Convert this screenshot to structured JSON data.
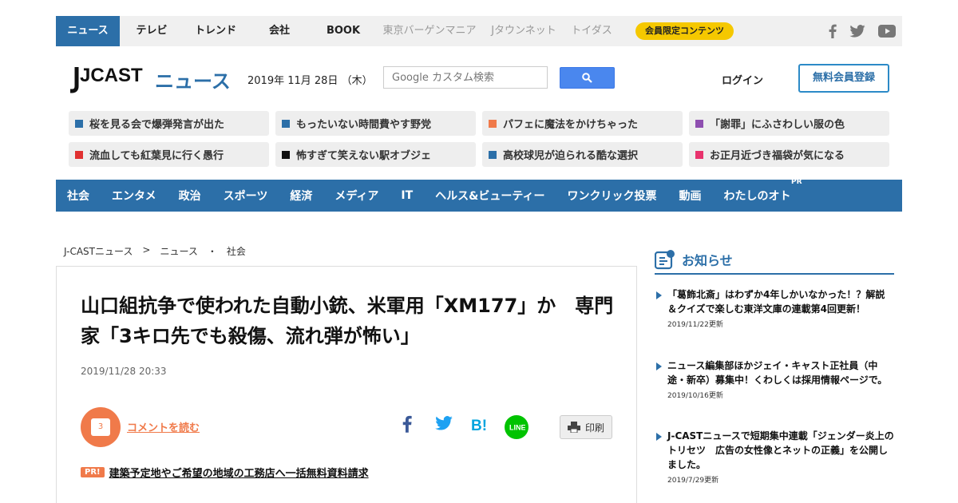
{
  "topnav": {
    "items": [
      "ニュース",
      "テレビ",
      "トレンド",
      "会社",
      "BOOK",
      "東京バーゲンマニア",
      "Jタウンネット",
      "トイダス"
    ],
    "members_badge": "会員限定コンテンツ",
    "social_icons": [
      "facebook-icon",
      "twitter-icon",
      "youtube-icon"
    ]
  },
  "header": {
    "logo_main": "JCAST",
    "logo_sub": "ニュース",
    "date": "2019年 11月 28日 （木）",
    "search_placeholder": "Google カスタム検索",
    "login": "ログイン",
    "register": "無料会員登録"
  },
  "tags": [
    {
      "label": "桜を見る会で爆弾発言が出た",
      "color": "#2c6fa8"
    },
    {
      "label": "もったいない時間費やす野党",
      "color": "#2c6fa8"
    },
    {
      "label": "パフェに魔法をかけちゃった",
      "color": "#f07a4a"
    },
    {
      "label": "「謝罪」にふさわしい服の色",
      "color": "#8e4fb0"
    },
    {
      "label": "流血しても紅葉見に行く愚行",
      "color": "#e03030"
    },
    {
      "label": "怖すぎて笑えない駅オブジェ",
      "color": "#111111"
    },
    {
      "label": "高校球児が迫られる酷な選択",
      "color": "#2c6fa8"
    },
    {
      "label": "お正月近づき福袋が気になる",
      "color": "#e8336d"
    }
  ],
  "categories": [
    "社会",
    "エンタメ",
    "政治",
    "スポーツ",
    "経済",
    "メディア",
    "IT",
    "ヘルス&ビューティー",
    "ワンクリック投票",
    "動画",
    "わたしのオト"
  ],
  "categories_pr": "PR",
  "breadcrumb": [
    "J-CASTニュース",
    ">",
    "ニュース",
    "・",
    "社会"
  ],
  "article": {
    "title": "山口組抗争で使われた自動小銃、米軍用「XM177」か　専門家「3キロ先でも殺傷、流れ弾が怖い」",
    "date": "2019/11/28 20:33",
    "comment_count": "3",
    "comment_link": "コメントを読む",
    "print": "印刷",
    "promo_badge": "PR!",
    "promo_link": "建築予定地やご希望の地域の工務店へ一括無料資料請求"
  },
  "sidebar": {
    "title": "お知らせ",
    "notices": [
      {
        "text": "「葛飾北斎」はわずか4年しかいなかった！？解説＆クイズで楽しむ東洋文庫の連載第4回更新！",
        "updated": "2019/11/22更新"
      },
      {
        "text": "ニュース編集部ほかジェイ・キャスト正社員（中途・新卒）募集中！くわしくは採用情報ページで。",
        "updated": "2019/10/16更新"
      },
      {
        "text": "J-CASTニュースで短期集中連載「ジェンダー炎上のトリセツ　広告の女性像とネットの正義」を公開しました。",
        "updated": "2019/7/29更新"
      }
    ]
  }
}
